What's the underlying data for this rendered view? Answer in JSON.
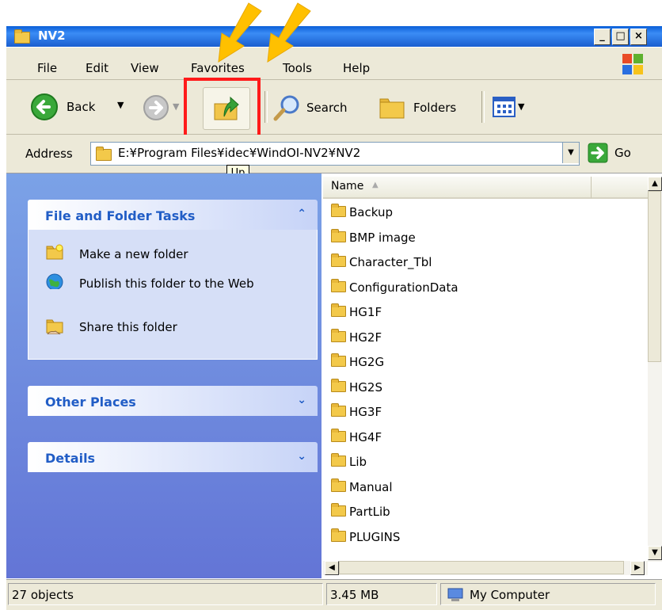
{
  "window": {
    "title": "NV2"
  },
  "caption_buttons": [
    "_",
    "□",
    "×"
  ],
  "menu": {
    "items": [
      "File",
      "Edit",
      "View",
      "Favorites",
      "Tools",
      "Help"
    ]
  },
  "toolbar": {
    "back_label": "Back",
    "search_label": "Search",
    "folders_label": "Folders",
    "tooltip": "Up"
  },
  "address": {
    "label": "Address",
    "value": "E:¥Program Files¥idec¥WindOI-NV2¥NV2",
    "go_label": "Go"
  },
  "left_pane": {
    "file_folder_tasks": {
      "title": "File and Folder Tasks",
      "chevron": "⌃",
      "tasks": [
        {
          "label": "Make a new folder",
          "icon": "new-folder-icon"
        },
        {
          "label": "Publish this folder to the Web",
          "icon": "globe-icon"
        },
        {
          "label": "Share this folder",
          "icon": "share-folder-icon"
        }
      ]
    },
    "other_places": {
      "title": "Other Places",
      "chevron": "⌄"
    },
    "details": {
      "title": "Details",
      "chevron": "⌄"
    }
  },
  "file_list": {
    "column_header": "Name",
    "items": [
      "Backup",
      "BMP image",
      "Character_Tbl",
      "ConfigurationData",
      "HG1F",
      "HG2F",
      "HG2G",
      "HG2S",
      "HG3F",
      "HG4F",
      "Lib",
      "Manual",
      "PartLib",
      "PLUGINS"
    ]
  },
  "status": {
    "objects": "27 objects",
    "size": "3.45 MB",
    "location": "My Computer"
  },
  "colors": {
    "titlebar": "#0a5fd8",
    "annotation_box": "#ff0000",
    "annotation_arrow": "#ffc000"
  }
}
